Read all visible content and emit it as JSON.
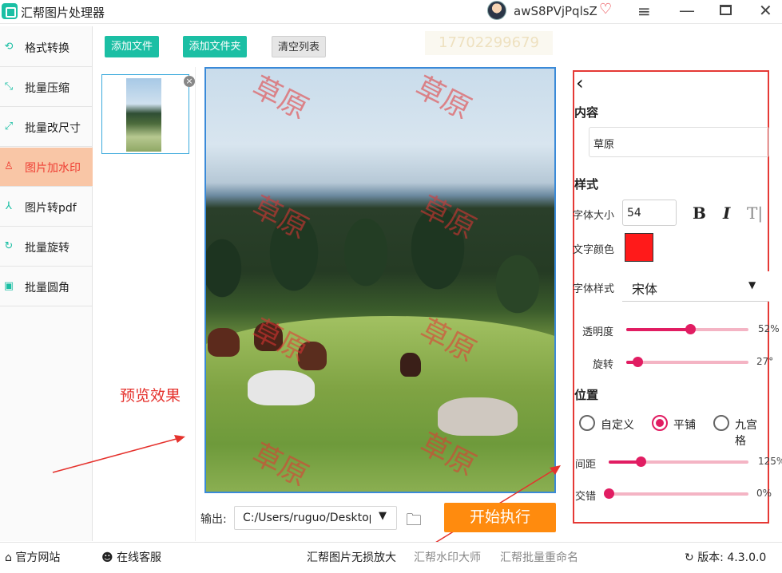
{
  "titlebar": {
    "app_title": "汇帮图片处理器",
    "username": "awS8PVjPqlsZ",
    "icons": [
      "app-icon",
      "avatar",
      "heart-icon",
      "menu-icon",
      "minimize-icon",
      "maximize-icon",
      "close-icon"
    ]
  },
  "sidebar": {
    "items": [
      {
        "label": "格式转换",
        "icon": "format-icon",
        "active": false
      },
      {
        "label": "批量压缩",
        "icon": "compress-icon",
        "active": false
      },
      {
        "label": "批量改尺寸",
        "icon": "resize-icon",
        "active": false
      },
      {
        "label": "图片加水印",
        "icon": "watermark-icon",
        "active": true
      },
      {
        "label": "图片转pdf",
        "icon": "pdf-icon",
        "active": false
      },
      {
        "label": "批量旋转",
        "icon": "rotate-icon",
        "active": false
      },
      {
        "label": "批量圆角",
        "icon": "round-corner-icon",
        "active": false
      }
    ]
  },
  "toolbar": {
    "add_file": "添加文件",
    "add_folder": "添加文件夹",
    "clear_list": "清空列表",
    "ghost_text": "17702299679"
  },
  "preview": {
    "watermark_text": "草原",
    "annotation": "预览效果"
  },
  "output": {
    "label": "输出:",
    "path": "C:/Users/ruguo/Desktop",
    "start_label": "开始执行"
  },
  "panel": {
    "back_icon": "chevron-left-icon",
    "content_title": "内容",
    "content_value": "草原",
    "style_title": "样式",
    "font_size_label": "字体大小",
    "font_size_value": "54",
    "bold": "B",
    "italic": "I",
    "text_format": "T|",
    "text_color_label": "文字颜色",
    "text_color": "#ff1a1a",
    "font_style_label": "字体样式",
    "font_style_value": "宋体",
    "opacity_label": "透明度",
    "opacity_value": "52%",
    "opacity_fraction": 0.52,
    "rotate_label": "旋转",
    "rotate_value": "27°",
    "rotate_fraction": 0.09,
    "position_title": "位置",
    "positions": [
      "自定义",
      "平铺",
      "九宫格"
    ],
    "position_selected": "平铺",
    "spacing_label": "间距",
    "spacing_value": "125%",
    "spacing_fraction": 0.23,
    "stagger_label": "交错",
    "stagger_value": "0%",
    "stagger_fraction": 0.0
  },
  "footer": {
    "official_site": "官方网站",
    "online_service": "在线客服",
    "link1": "汇帮图片无损放大",
    "link2": "汇帮水印大师",
    "link3": "汇帮批量重命名",
    "version_label": "版本:",
    "version": "4.3.0.0"
  },
  "colors": {
    "accent": "#1bbfa4",
    "active_bg": "#f9c6a6",
    "active_text": "#ef3e33",
    "start_button": "#ff8b0e",
    "slider": "#e11d62",
    "panel_border": "#e53935"
  }
}
